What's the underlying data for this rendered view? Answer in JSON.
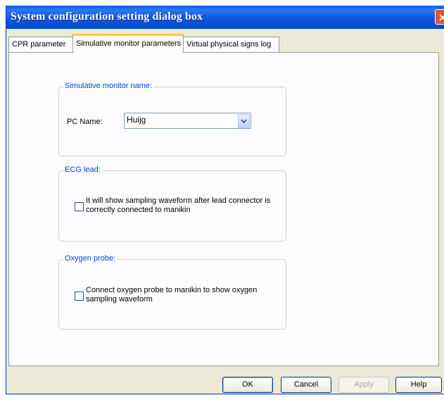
{
  "window": {
    "title": "System configuration setting dialog box",
    "close_symbol": "✕"
  },
  "tabs": [
    {
      "label": "CPR parameter",
      "active": false
    },
    {
      "label": "Simulative monitor parameters",
      "active": true
    },
    {
      "label": "Virtual physical signs log",
      "active": false
    }
  ],
  "monitor_name_group": {
    "title": "Simulative monitor name:",
    "pc_name_label": "PC Name:",
    "pc_name_value": "Huijg"
  },
  "ecg_group": {
    "title": "ECG lead:",
    "checkbox_label_line1": "It will show sampling waveform after lead connector is",
    "checkbox_label_line2": "correctly connected to manikin",
    "checked": false
  },
  "oxygen_group": {
    "title": "Oxygen probe:",
    "checkbox_label_line1": "Connect oxygen probe to manikin to show oxygen",
    "checkbox_label_line2": "sampling waveform",
    "checked": false
  },
  "buttons": {
    "ok": "OK",
    "cancel": "Cancel",
    "apply": "Apply",
    "help": "Help"
  }
}
